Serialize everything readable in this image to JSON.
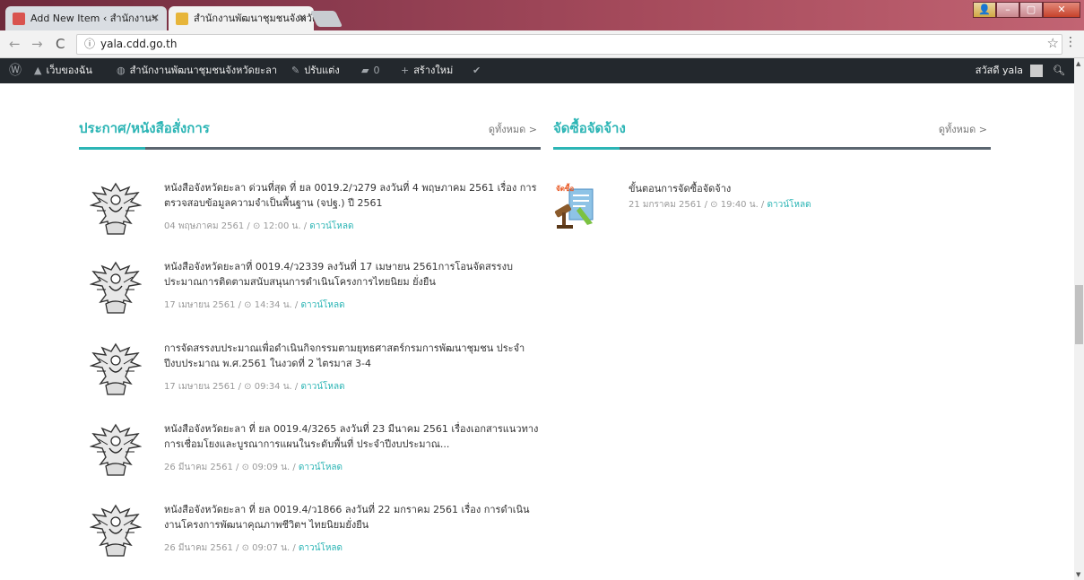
{
  "browser": {
    "tabs": [
      {
        "title": "Add New Item ‹ สำนักงานฯ"
      },
      {
        "title": "สำนักงานพัฒนาชุมชนจังหวัด"
      }
    ],
    "url": "yala.cdd.go.th"
  },
  "adminbar": {
    "my_sites": "เว็บของฉัน",
    "site_name": "สำนักงานพัฒนาชุมชนจังหวัดยะลา",
    "customize": "ปรับแต่ง",
    "comments_count": "0",
    "new": "สร้างใหม่",
    "greeting": "สวัสดี yala"
  },
  "announcements": {
    "title": "ประกาศ/หนังสือสั่งการ",
    "see_all": "ดูทั้งหมด >",
    "download_label": "ดาวน์โหลด",
    "items": [
      {
        "title": "หนังสือจังหวัดยะลา ด่วนที่สุด ที่ ยล 0019.2/ว279 ลงวันที่ 4 พฤษภาคม 2561 เรื่อง การตรวจสอบข้อมูลความจำเป็นพื้นฐาน (จปฐ.) ปี 2561",
        "date": "04 พฤษภาคม 2561 / ⊙ 12:00 น. /"
      },
      {
        "title": "หนังสือจังหวัดยะลาที่ 0019.4/ว2339 ลงวันที่ 17 เมษายน 2561การโอนจัดสรรงบประมาณการติดตามสนับสนุนการดำเนินโครงการไทยนิยม ยั่งยืน",
        "date": "17 เมษายน 2561 / ⊙ 14:34 น. /"
      },
      {
        "title": "การจัดสรรงบประมาณเพื่อดำเนินกิจกรรมตามยุทธศาสตร์กรมการพัฒนาชุมชน ประจำปีงบประมาณ พ.ศ.2561 ในงวดที่ 2 ไตรมาส 3-4",
        "date": "17 เมษายน 2561 / ⊙ 09:34 น. /"
      },
      {
        "title": "หนังสือจังหวัดยะลา ที่ ยล 0019.4/3265 ลงวันที่ 23 มีนาคม 2561 เรื่องเอกสารแนวทางการเชื่อมโยงและบูรณาการแผนในระดับพื้นที่ ประจำปีงบประมาณ...",
        "date": "26 มีนาคม 2561 / ⊙ 09:09 น. /"
      },
      {
        "title": "หนังสือจังหวัดยะลา ที่ ยล 0019.4/ว1866 ลงวันที่ 22 มกราคม 2561 เรื่อง การดำเนินงานโครงการพัฒนาคุณภาพชีวิตฯ ไทยนิยมยั่งยืน",
        "date": "26 มีนาคม 2561 / ⊙ 09:07 น. /"
      }
    ]
  },
  "procurement": {
    "title": "จัดซื้อจัดจ้าง",
    "see_all": "ดูทั้งหมด >",
    "icon_text": "จัดซื้อ จัดจ้าง",
    "items": [
      {
        "title": "ขั้นตอนการจัดซื้อจัดจ้าง",
        "date": "21 มกราคม 2561 / ⊙ 19:40 น. /",
        "download": "ดาวน์โหลด"
      }
    ]
  },
  "colors": {
    "accent": "#2cb5b5",
    "adminbar": "#23282d"
  }
}
